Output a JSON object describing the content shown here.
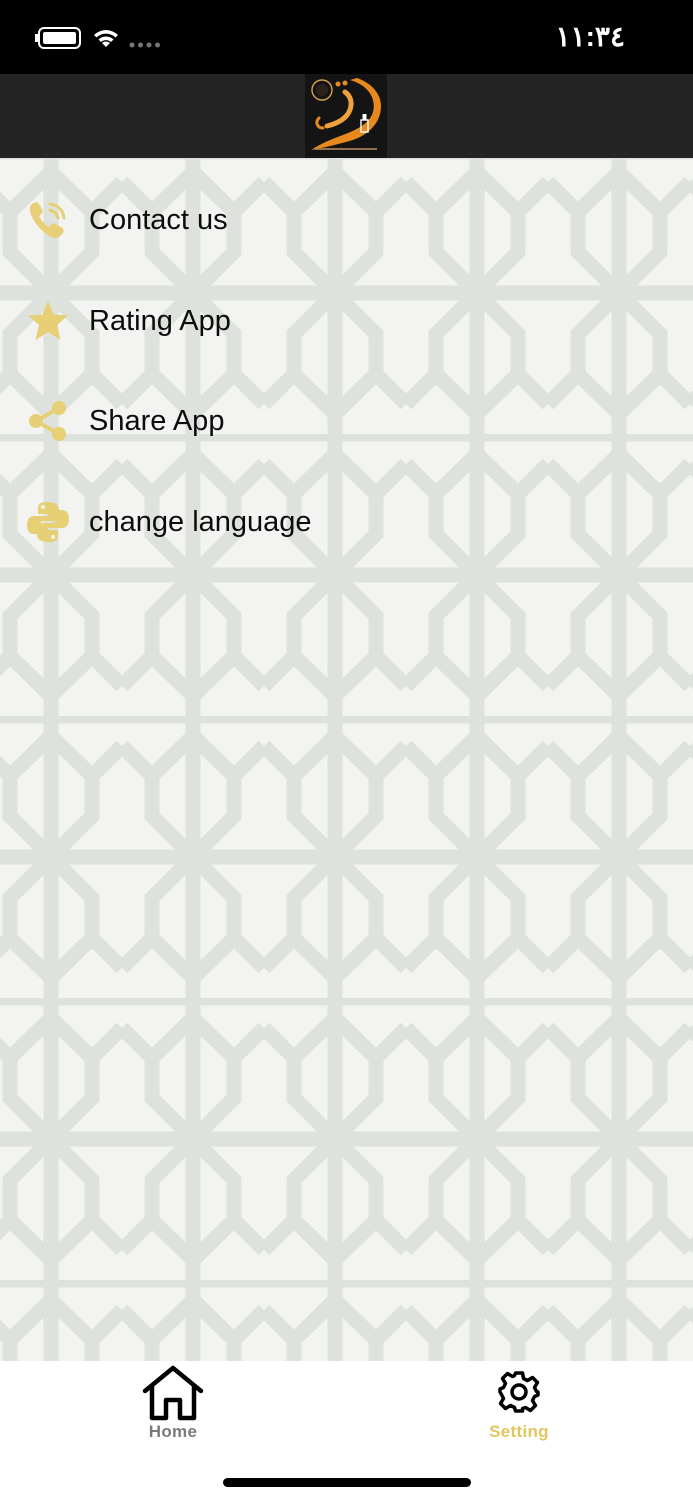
{
  "status_bar": {
    "time": "١١:٣٤"
  },
  "header": {
    "logo_icon": "najm-calligraphy-logo"
  },
  "menu": {
    "items": [
      {
        "label": "Contact us",
        "icon": "phone-icon"
      },
      {
        "label": "Rating App",
        "icon": "star-icon"
      },
      {
        "label": "Share App",
        "icon": "share-icon"
      },
      {
        "label": "change language",
        "icon": "python-logo-icon"
      }
    ]
  },
  "tab_bar": {
    "tabs": [
      {
        "label": "Home",
        "icon": "home-icon",
        "active": false
      },
      {
        "label": "Setting",
        "icon": "gear-icon",
        "active": true
      }
    ]
  },
  "colors": {
    "accent": "#e3c65d",
    "icon_gold": "#e6cf74",
    "inactive_tab": "#7a7a7a",
    "header_bg": "#242424",
    "status_bar_bg": "#000000"
  }
}
